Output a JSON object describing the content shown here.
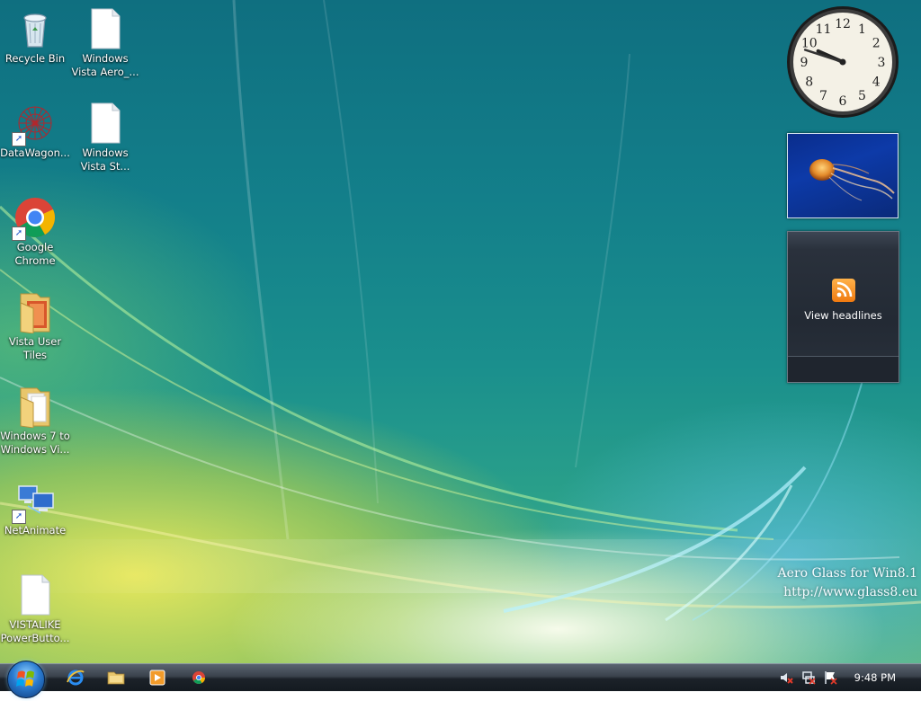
{
  "desktop": {
    "icons": [
      {
        "label": "Recycle Bin",
        "icon": "recycle-bin-icon"
      },
      {
        "label": "Windows Vista Aero_...",
        "icon": "document-icon"
      },
      {
        "label": "DataWagon...",
        "icon": "datawagon-shortcut-icon"
      },
      {
        "label": "Windows Vista St...",
        "icon": "document-icon"
      },
      {
        "label": "Google Chrome",
        "icon": "chrome-icon"
      },
      {
        "label": "Vista User Tiles",
        "icon": "folder-icon"
      },
      {
        "label": "Windows 7 to Windows Vi...",
        "icon": "folder-icon"
      },
      {
        "label": "NetAnimate",
        "icon": "network-computers-icon"
      },
      {
        "label": "VISTALIKE PowerButto...",
        "icon": "document-icon"
      }
    ]
  },
  "gadgets": {
    "clock": {
      "numerals": [
        "12",
        "1",
        "2",
        "3",
        "4",
        "5",
        "6",
        "7",
        "8",
        "9",
        "10",
        "11"
      ],
      "time": "9:48"
    },
    "slideshow": {
      "image": "jellyfish-photo"
    },
    "feed": {
      "label": "View headlines",
      "icon": "rss-icon"
    }
  },
  "watermark": {
    "line1": "Aero Glass for Win8.1",
    "line2": "http://www.glass8.eu"
  },
  "taskbar": {
    "start": "windows-start-orb",
    "pinned": [
      "internet-explorer-icon",
      "file-explorer-icon",
      "media-player-icon",
      "chrome-icon"
    ],
    "tray_icons": [
      "volume-muted-icon",
      "network-disconnected-icon",
      "action-center-icon"
    ],
    "time": "9:48 PM"
  },
  "colors": {
    "wallpaper_top": "#0f6f80",
    "wallpaper_glow": "#f0eb5a",
    "taskbar": "#1c2229"
  }
}
